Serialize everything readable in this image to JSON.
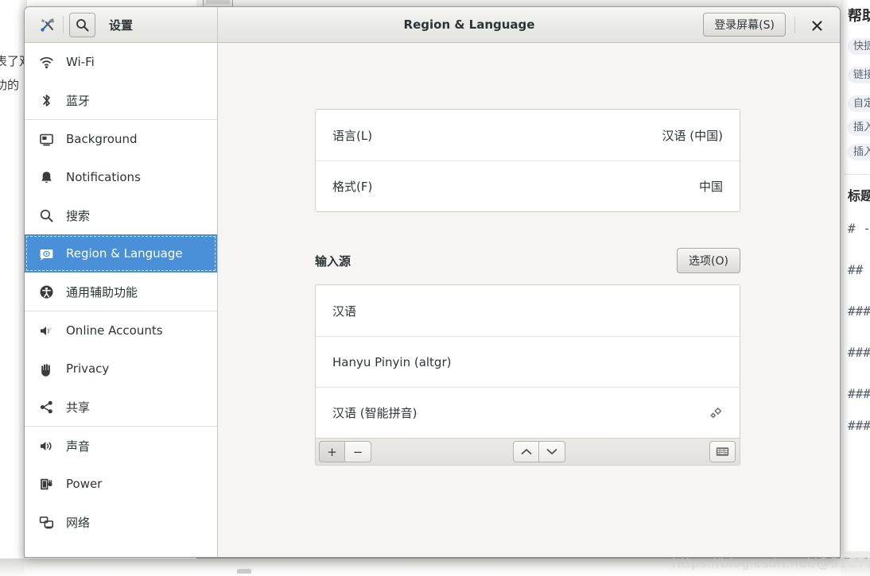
{
  "background": {
    "left_text_lines": [
      "表了双",
      "功的"
    ],
    "right_panel": {
      "title": "帮助",
      "pills": [
        "快捷",
        "链接",
        "自定",
        "插入",
        "插入"
      ],
      "subtitle": "标题",
      "markdown_hints": [
        "# -",
        "##",
        "###",
        "###",
        "###",
        "###"
      ]
    },
    "watermark": "https://blog.csdn.net/@51CTO博客"
  },
  "window": {
    "titlebar": {
      "app_icon": "tools-icon",
      "search_icon": "search-icon",
      "left_title": "设置",
      "main_title": "Region & Language",
      "login_screen_label": "登录屏幕(S)",
      "close_label": "×"
    }
  },
  "sidebar": {
    "groups": [
      {
        "items": [
          {
            "icon": "wifi-icon",
            "label": "Wi-Fi",
            "selected": false
          },
          {
            "icon": "bluetooth-icon",
            "label": "蓝牙",
            "selected": false
          }
        ]
      },
      {
        "items": [
          {
            "icon": "background-icon",
            "label": "Background",
            "selected": false
          },
          {
            "icon": "notifications-bell-icon",
            "label": "Notifications",
            "selected": false
          },
          {
            "icon": "search-icon",
            "label": "搜索",
            "selected": false
          },
          {
            "icon": "region-language-icon",
            "label": "Region & Language",
            "selected": true
          },
          {
            "icon": "accessibility-icon",
            "label": "通用辅助功能",
            "selected": false
          }
        ]
      },
      {
        "items": [
          {
            "icon": "online-accounts-icon",
            "label": "Online Accounts",
            "selected": false
          },
          {
            "icon": "privacy-hand-icon",
            "label": "Privacy",
            "selected": false
          },
          {
            "icon": "sharing-icon",
            "label": "共享",
            "selected": false
          }
        ]
      },
      {
        "items": [
          {
            "icon": "sound-speaker-icon",
            "label": "声音",
            "selected": false
          },
          {
            "icon": "power-battery-icon",
            "label": "Power",
            "selected": false
          },
          {
            "icon": "network-icon",
            "label": "网络",
            "selected": false
          }
        ]
      }
    ]
  },
  "main": {
    "language_card": [
      {
        "label": "语言(L)",
        "value": "汉语 (中国)"
      },
      {
        "label": "格式(F)",
        "value": "中国"
      }
    ],
    "input_sources": {
      "section_title": "输入源",
      "options_button": "选项(O)",
      "items": [
        {
          "label": "汉语",
          "has_settings": false
        },
        {
          "label": "Hanyu Pinyin (altgr)",
          "has_settings": false
        },
        {
          "label": "汉语 (智能拼音)",
          "has_settings": true,
          "settings_icon": "gears-icon"
        }
      ],
      "toolbar": {
        "add_label": "+",
        "remove_label": "−",
        "move_up_icon": "chevron-up-icon",
        "move_down_icon": "chevron-down-icon",
        "keyboard_icon": "keyboard-icon"
      }
    }
  },
  "colors": {
    "accent": "#4a90d9",
    "content_bg": "#f6f5f4",
    "text": "#2e3436"
  }
}
